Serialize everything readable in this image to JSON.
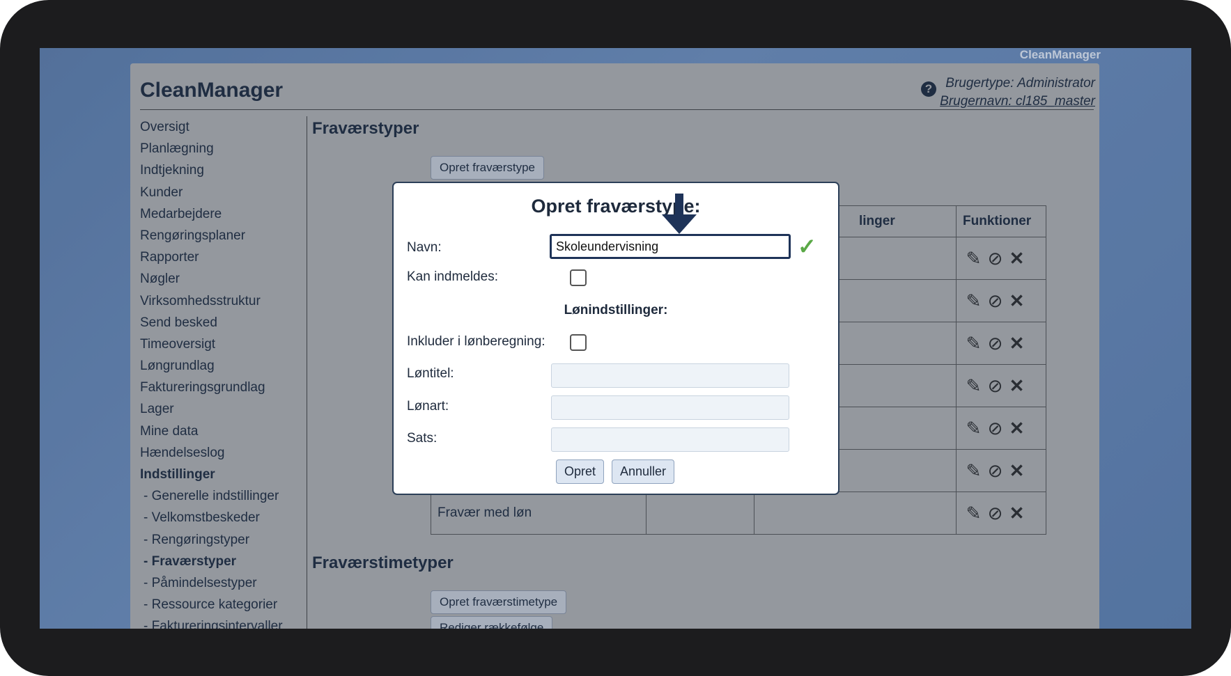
{
  "app": {
    "brand_top": "CleanManager",
    "title": "CleanManager",
    "help_icon": "?",
    "user_type": "Brugertype: Administrator",
    "user_name": "Brugernavn: cl185_master"
  },
  "sidebar": {
    "items": [
      {
        "label": "Oversigt"
      },
      {
        "label": "Planlægning"
      },
      {
        "label": "Indtjekning"
      },
      {
        "label": "Kunder"
      },
      {
        "label": "Medarbejdere"
      },
      {
        "label": "Rengøringsplaner"
      },
      {
        "label": "Rapporter"
      },
      {
        "label": "Nøgler"
      },
      {
        "label": "Virksomhedsstruktur"
      },
      {
        "label": "Send besked"
      },
      {
        "label": "Timeoversigt"
      },
      {
        "label": "Løngrundlag"
      },
      {
        "label": "Faktureringsgrundlag"
      },
      {
        "label": "Lager"
      },
      {
        "label": "Mine data"
      },
      {
        "label": "Hændelseslog"
      },
      {
        "label": "Indstillinger"
      },
      {
        "label": "- Generelle indstillinger"
      },
      {
        "label": "- Velkomstbeskeder"
      },
      {
        "label": "- Rengøringstyper"
      },
      {
        "label": "- Fraværstyper"
      },
      {
        "label": "- Påmindelsestyper"
      },
      {
        "label": "- Ressource kategorier"
      },
      {
        "label": "- Faktureringsintervaller"
      }
    ]
  },
  "main": {
    "section1_title": "Fraværstyper",
    "create_button": "Opret fraværstype",
    "table_header_partial": "linger",
    "table_header_functions": "Funktioner",
    "last_row_name": "Fravær med løn",
    "section2_title": "Fraværstimetyper",
    "create_hour_button": "Opret fraværstimetype",
    "reorder_button": "Rediger rækkefølge"
  },
  "icons": {
    "edit": "pencil-icon",
    "hide": "eye-slash-icon",
    "delete": "x-icon"
  },
  "modal": {
    "title": "Opret fraværstype:",
    "name_label": "Navn:",
    "name_value": "Skoleundervisning",
    "can_report_label": "Kan indmeldes:",
    "salary_heading": "Lønindstillinger:",
    "include_salary_label": "Inkluder i lønberegning:",
    "salary_title_label": "Løntitel:",
    "salary_type_label": "Lønart:",
    "rate_label": "Sats:",
    "create_button": "Opret",
    "cancel_button": "Annuller"
  },
  "colors": {
    "accent": "#1e3358",
    "valid": "#5aa846"
  }
}
